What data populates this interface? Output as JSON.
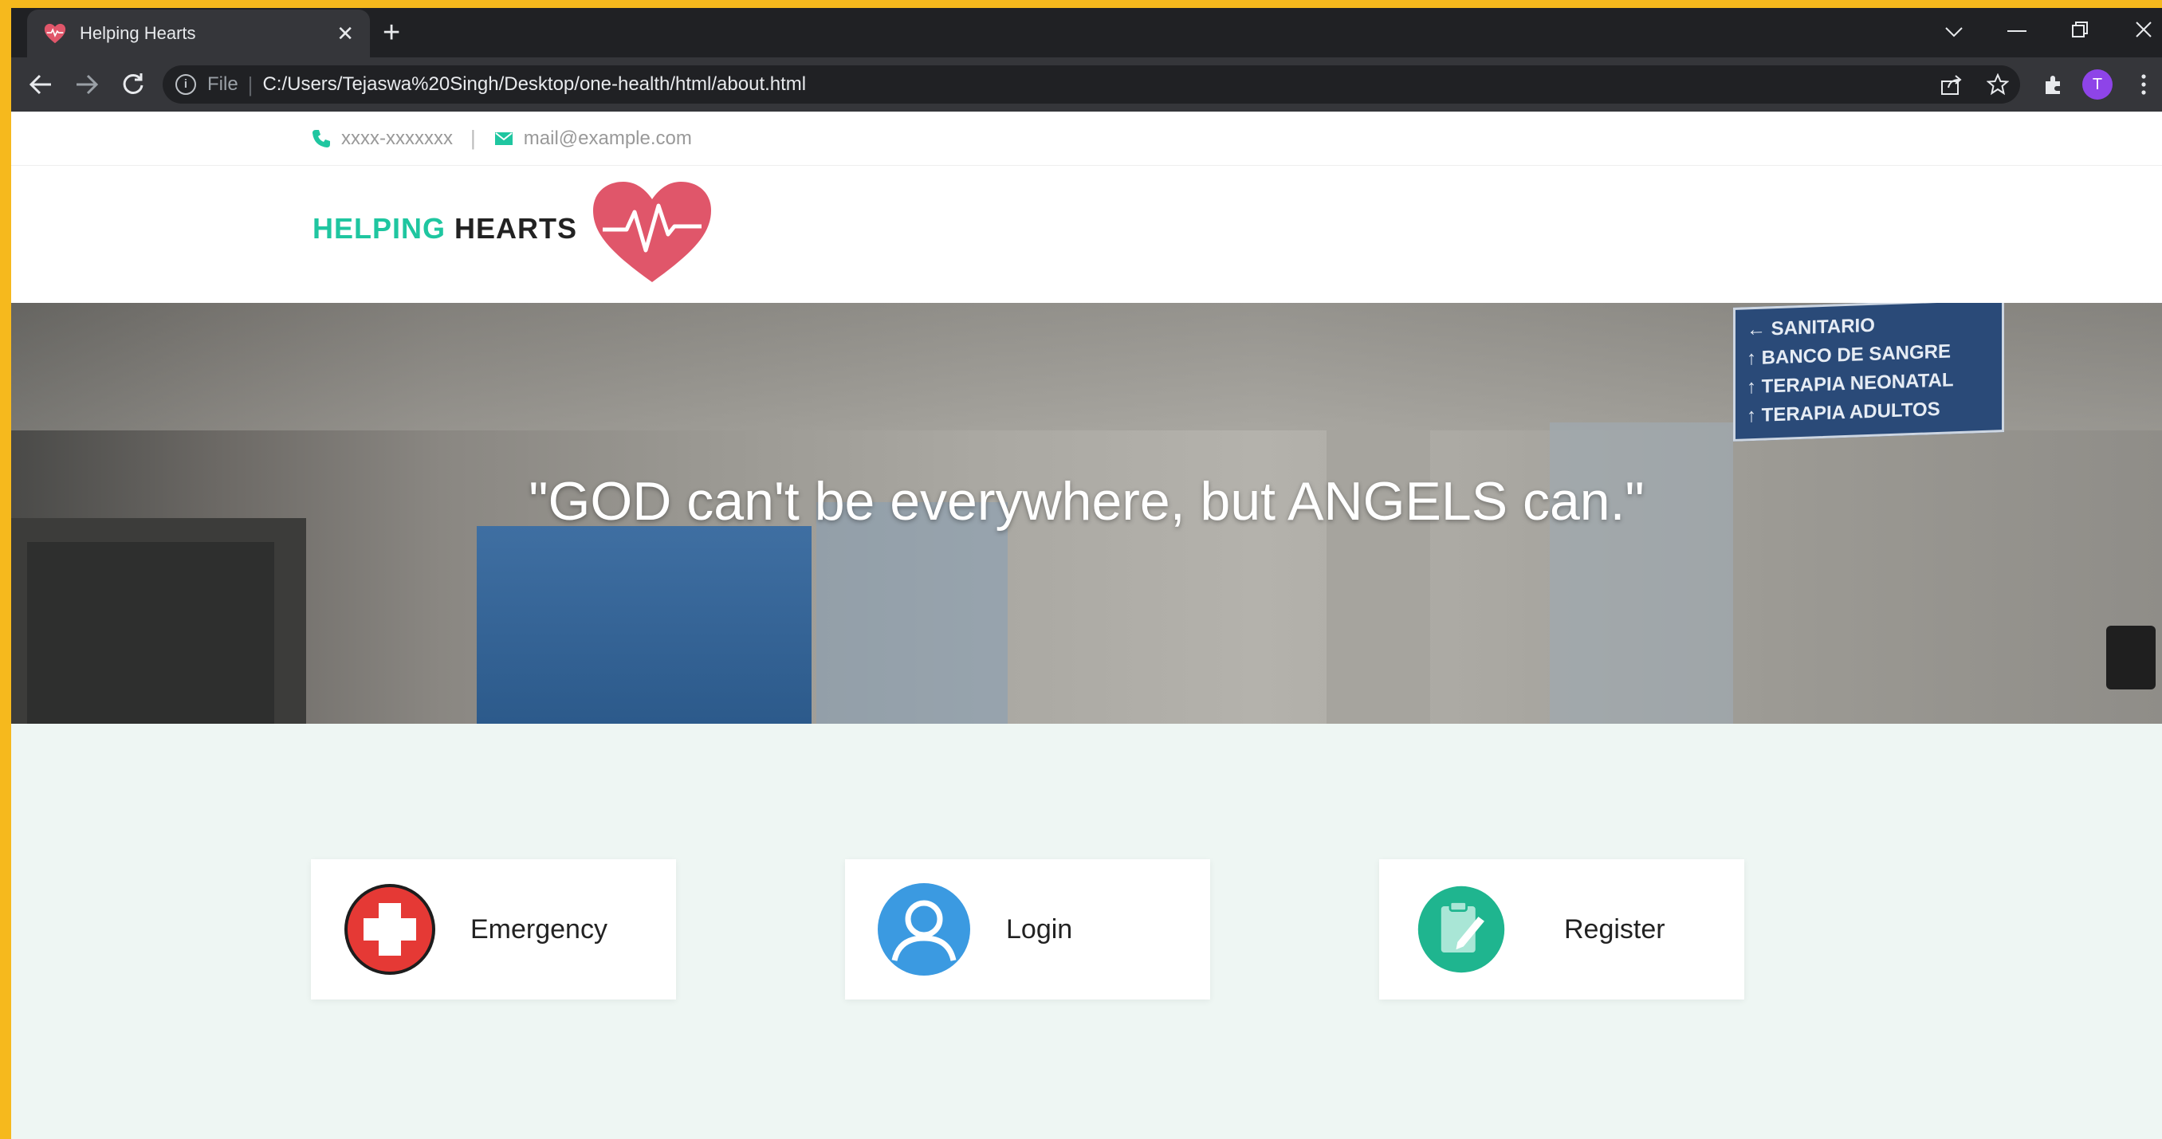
{
  "browser": {
    "tab_title": "Helping Hearts",
    "tab_close": "✕",
    "new_tab": "+",
    "scheme": "File",
    "separator": "|",
    "url": "C:/Users/Tejaswa%20Singh/Desktop/one-health/html/about.html",
    "profile_initial": "T",
    "icons": [
      "back-arrow-icon",
      "forward-arrow-icon",
      "reload-icon",
      "info-icon",
      "share-icon",
      "star-icon",
      "extensions-icon",
      "menu-icon",
      "chevron-down-icon",
      "minimize-icon",
      "restore-icon",
      "close-icon"
    ]
  },
  "topbar": {
    "phone": "xxxx-xxxxxxx",
    "separator": "|",
    "email": "mail@example.com"
  },
  "brand": {
    "part1": "HELPING",
    "part2": " HEARTS"
  },
  "hero": {
    "quote": "\"GOD can't be everywhere, but ANGELS can.\"",
    "sign_lines": [
      "SANITARIO",
      "BANCO DE SANGRE",
      "TERAPIA NEONATAL",
      "TERAPIA ADULTOS"
    ]
  },
  "cards": [
    {
      "label": "Emergency",
      "icon": "emergency-cross-icon"
    },
    {
      "label": "Login",
      "icon": "user-icon"
    },
    {
      "label": "Register",
      "icon": "clipboard-edit-icon"
    }
  ],
  "colors": {
    "accent": "#1fc6a0",
    "heart": "#e0566a",
    "emergency": "#e53935",
    "login": "#3b9ae1",
    "register": "#1fb58f",
    "frame": "#f6b91d"
  }
}
